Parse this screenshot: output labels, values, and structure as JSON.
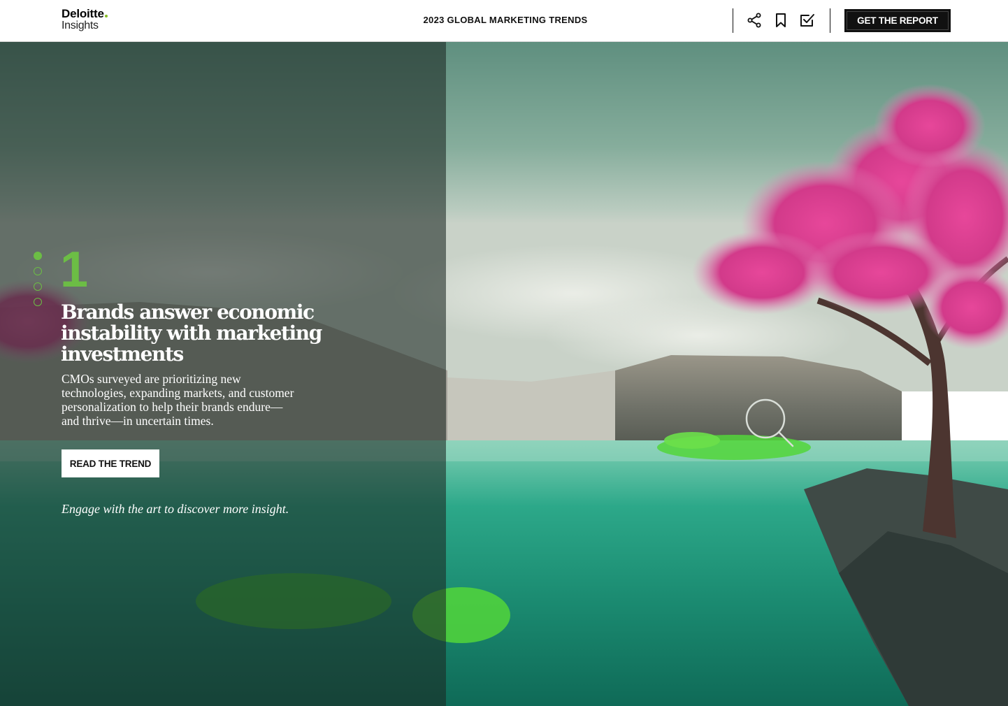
{
  "header": {
    "logo_word": "Deloitte",
    "logo_sub": "Insights",
    "title": "2023 GLOBAL MARKETING TRENDS",
    "icons": [
      "share-icon",
      "bookmark-icon",
      "checkbox-icon"
    ],
    "cta_label": "GET THE REPORT"
  },
  "trend": {
    "number": "1",
    "title": "Brands answer economic instability with marketing investments",
    "description": "CMOs surveyed are prioritizing new technologies, expanding markets, and customer personalization to help their brands endure—and thrive—in uncertain times.",
    "read_label": "READ THE TREND",
    "engage_text": "Engage with the art to discover more insight."
  },
  "pagination": {
    "count": 4,
    "active": 1
  },
  "hero": {
    "hotspot_icon": "magnifier-icon"
  },
  "colors": {
    "accent": "#6cbd45",
    "brand_dot": "#86bc25",
    "header_bg": "#ffffff",
    "cta_bg": "#111111"
  }
}
